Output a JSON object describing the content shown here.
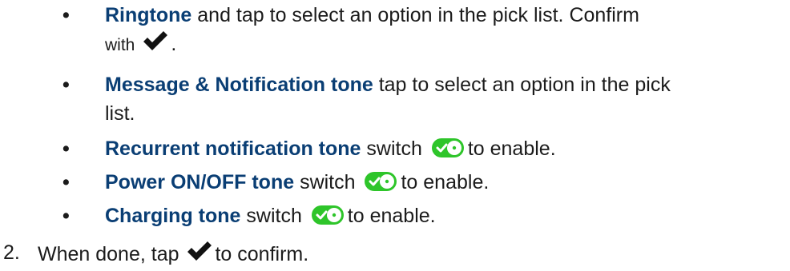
{
  "bullet_symbol": "•",
  "items": [
    {
      "term": "Ringtone",
      "text": " and tap to select an option in the pick list. Confirm",
      "continuation_pre": "with",
      "continuation_icon": "checkmark-icon",
      "continuation_post": "."
    },
    {
      "term": "Message & Notification tone",
      "text": " tap to select an option in the pick",
      "continuation": "list."
    },
    {
      "term": "Recurrent notification tone",
      "pre": " switch",
      "icon": "toggle-on-icon",
      "post": "to enable."
    },
    {
      "term": "Power ON/OFF tone",
      "pre": " switch",
      "icon": "toggle-on-icon",
      "post": "to enable."
    },
    {
      "term": "Charging tone",
      "pre": " switch",
      "icon": "toggle-on-icon",
      "post": "to enable."
    }
  ],
  "step2": {
    "number": "2.",
    "pre": "When done, tap",
    "icon": "checkmark-icon",
    "post": "to confirm."
  },
  "colors": {
    "term": "#0a3e74",
    "toggle_track": "#2ec52a",
    "body_text": "#1b1b1b"
  }
}
